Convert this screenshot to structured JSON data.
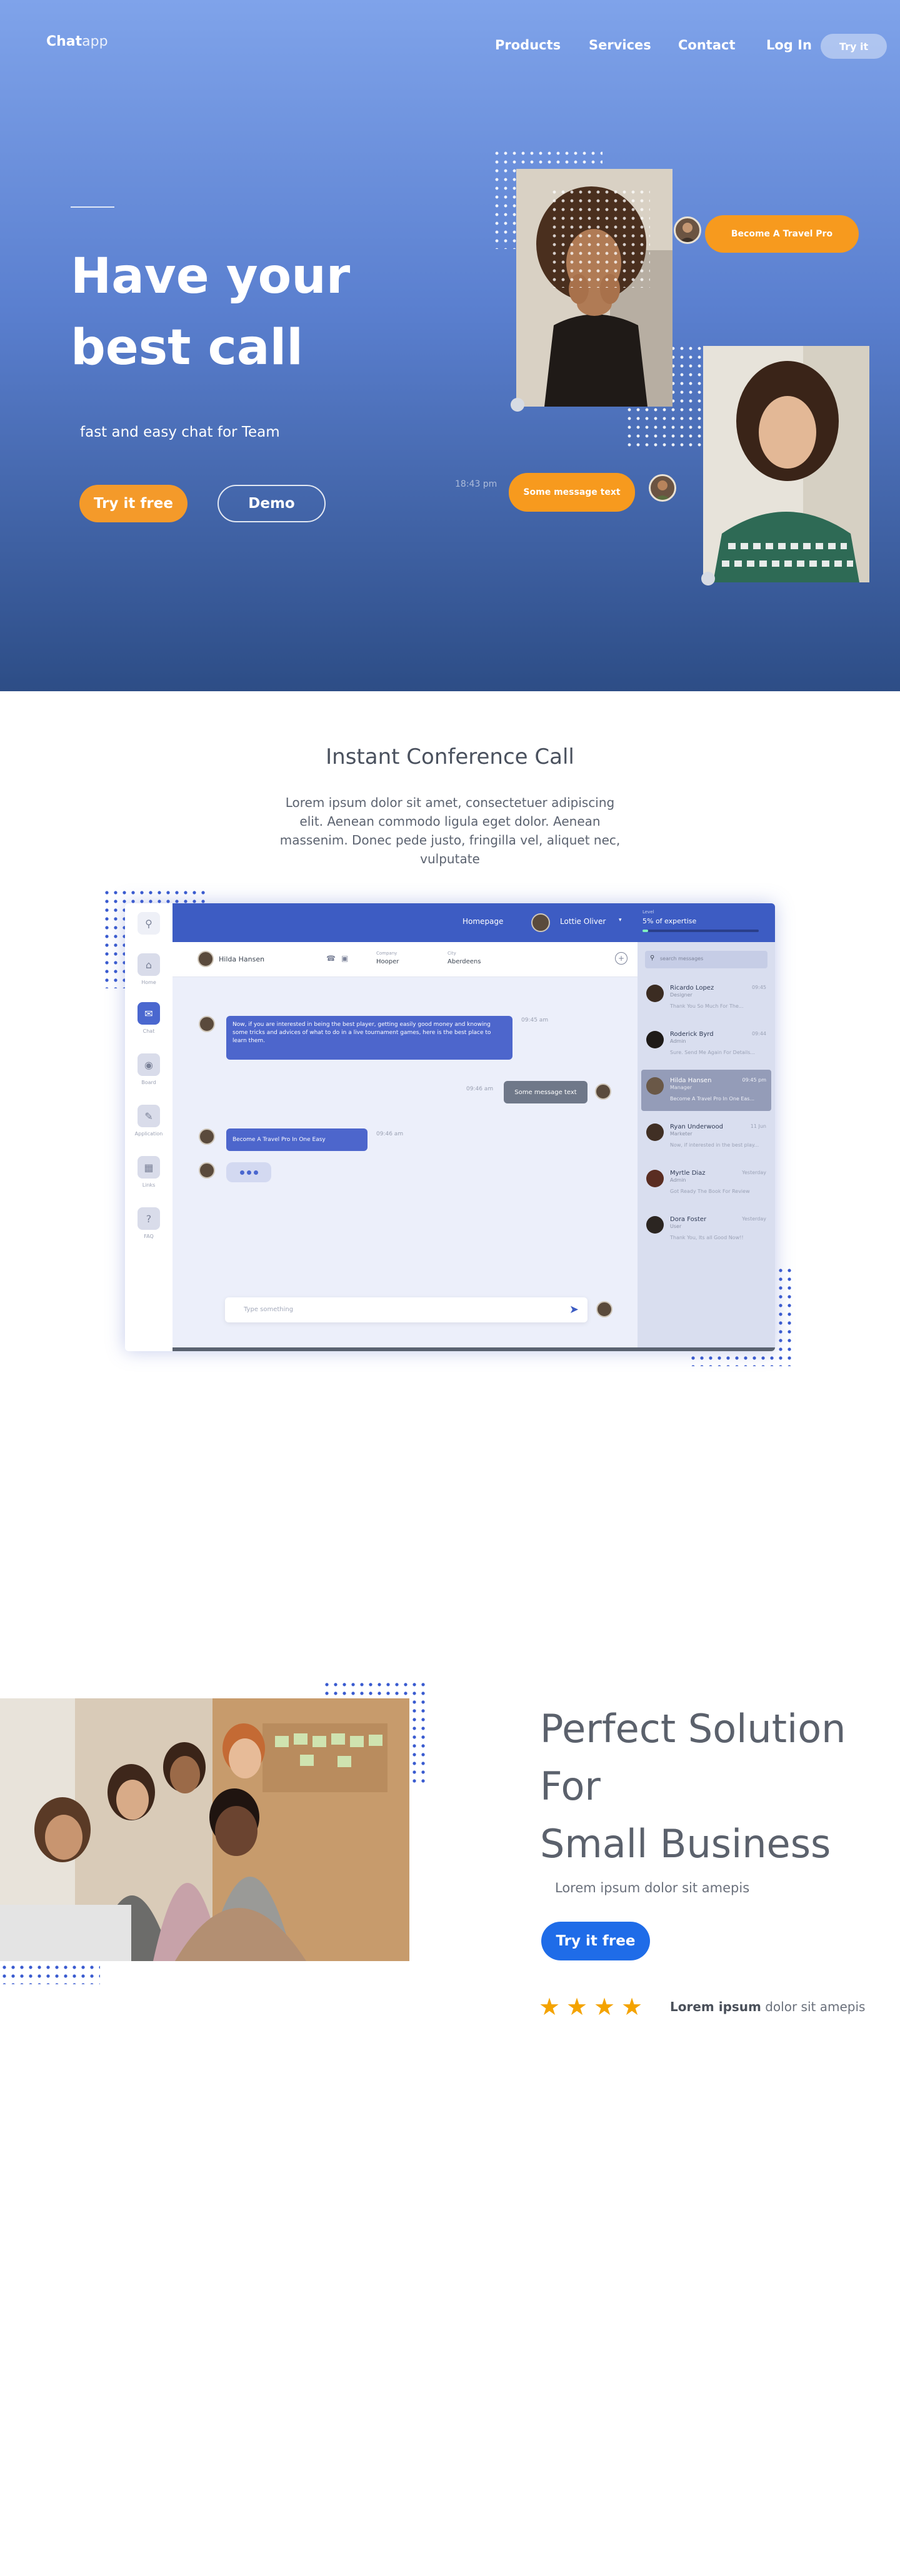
{
  "brand": {
    "logo_bold": "Chat",
    "logo_thin": "app"
  },
  "nav": {
    "items": [
      "Products",
      "Services",
      "Contact",
      "Log In"
    ],
    "cta": "Try it"
  },
  "hero": {
    "title": "Have your best call",
    "subtitle": "fast and easy chat for Team",
    "primary_btn": "Try it free",
    "secondary_btn": "Demo",
    "bubble_top": "Become A Travel Pro",
    "bubble_bottom": "Some message text",
    "bubble_time": "18:43 pm"
  },
  "conference": {
    "title": "Instant Conference Call",
    "text": "Lorem ipsum dolor sit amet, consectetuer adipiscing elit. Aenean commodo  ligula eget dolor. Aenean massenim. Donec pede justo, fringilla vel, aliquet nec, vulputate"
  },
  "app": {
    "top": {
      "homepage": "Homepage",
      "user": "Lottie Oliver",
      "level_label": "Level",
      "level_value": "5% of expertise"
    },
    "sidebar": [
      "Home",
      "Chat",
      "Board",
      "Application",
      "Links",
      "FAQ"
    ],
    "chat_header": {
      "name": "Hilda Hansen",
      "company_label": "Company",
      "company": "Hooper",
      "city_label": "City",
      "city": "Aberdeens"
    },
    "messages": {
      "m1": "Now, if you are interested in being the best player, getting easily good money and knowing some tricks and advices of what to do in a live tournament games, here is the best place to learn them.",
      "m1_time": "09:45 am",
      "m2": "Some message text",
      "m2_time": "09:46 am",
      "m3": "Become A Travel Pro In One Easy",
      "m3_time": "09:46 am"
    },
    "compose_placeholder": "Type something",
    "search_placeholder": "search messages",
    "contacts": [
      {
        "name": "Ricardo Lopez",
        "role": "Designer",
        "msg": "Thank You So Much For The...",
        "time": "09:45"
      },
      {
        "name": "Roderick Byrd",
        "role": "Admin",
        "msg": "Sure. Send Me Again For Details...",
        "time": "09:44"
      },
      {
        "name": "Hilda Hansen",
        "role": "Manager",
        "msg": "Become A Travel Pro In One Eas...",
        "time": "09:45 pm"
      },
      {
        "name": "Ryan Underwood",
        "role": "Marketer",
        "msg": "Now, if interested in the best play...",
        "time": "11 Jun"
      },
      {
        "name": "Myrtle Diaz",
        "role": "Admin",
        "msg": "Got Ready The Book For Review",
        "time": "Yesterday"
      },
      {
        "name": "Dora Foster",
        "role": "User",
        "msg": "Thank You, Its all Good Now!!",
        "time": "Yesterday"
      }
    ]
  },
  "solution": {
    "title_lines": [
      "Perfect Solution",
      "For",
      "Small Business"
    ],
    "subtitle": "Lorem ipsum dolor sit amepis",
    "cta": "Try it free",
    "rating_bold": "Lorem ipsum",
    "rating_rest": " dolor sit amepis",
    "stars": 4
  },
  "colors": {
    "orange": "#f49a2a",
    "blue": "#1f6ce8",
    "app_blue": "#3d5cc3",
    "star": "#f4a300"
  }
}
